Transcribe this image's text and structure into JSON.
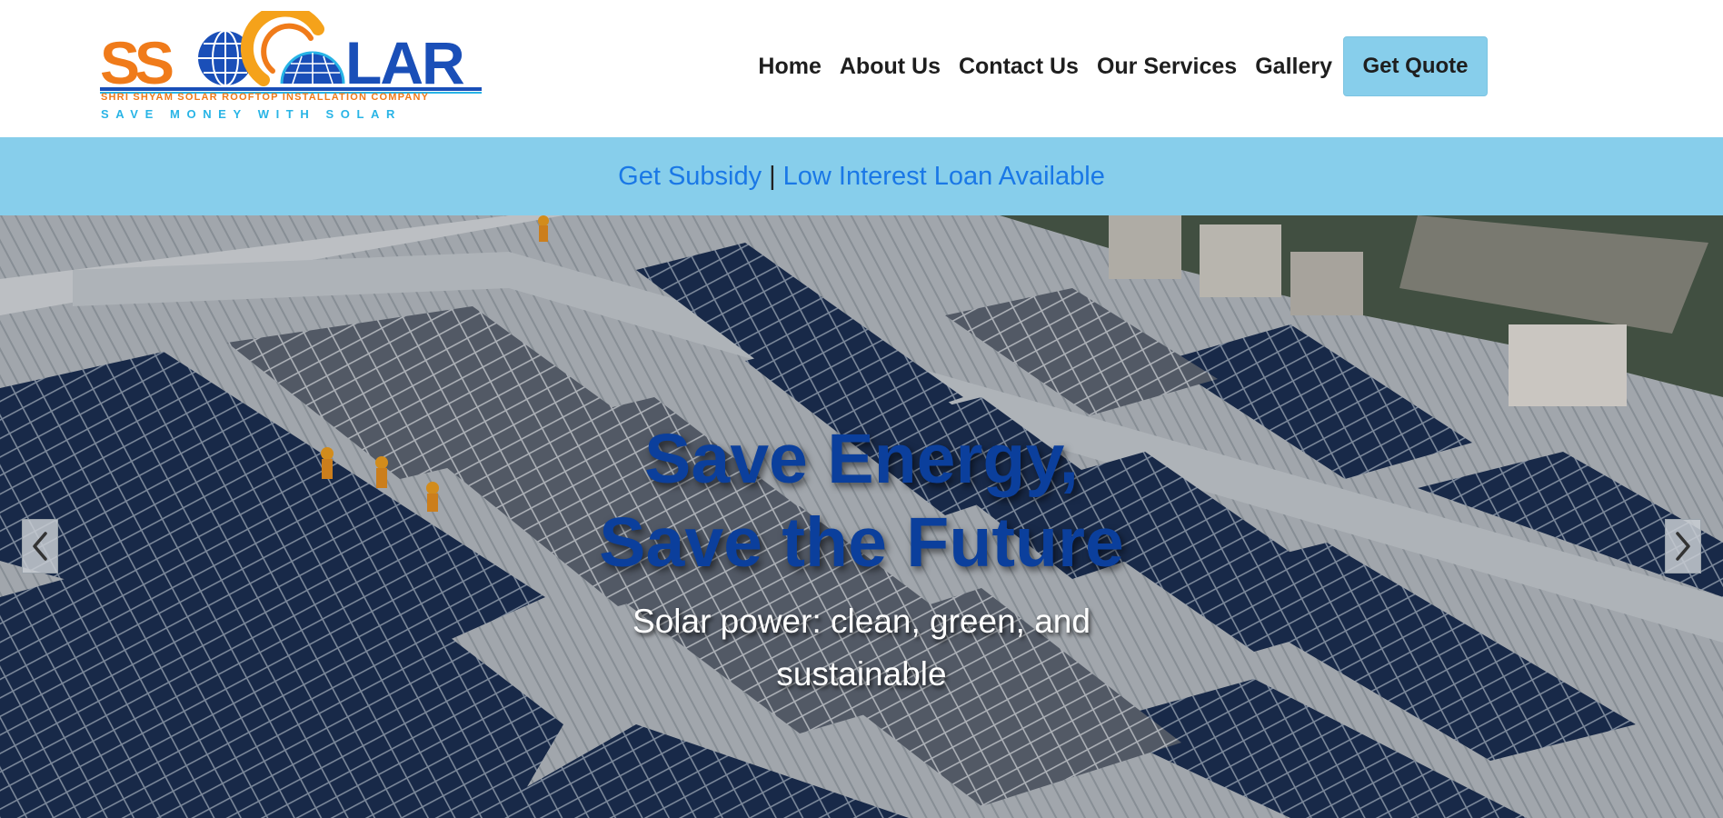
{
  "header": {
    "logo": {
      "wordmark": "SSOLAR",
      "tagline": "SHRI SHYAM SOLAR ROOFTOP INSTALLATION COMPANY",
      "slogan": "SAVE MONEY WITH SOLAR"
    },
    "nav": [
      {
        "label": "Home"
      },
      {
        "label": "About Us"
      },
      {
        "label": "Contact Us"
      },
      {
        "label": "Our Services"
      },
      {
        "label": "Gallery"
      }
    ],
    "cta_label": "Get Quote"
  },
  "announcement": {
    "subsidy": "Get Subsidy",
    "separator": "|",
    "loan": "Low Interest Loan Available"
  },
  "hero": {
    "title": "Save Energy, Save the Future",
    "subtitle": "Solar power: clean, green, and sustainable",
    "prev_icon": "chevron-left-icon",
    "next_icon": "chevron-right-icon"
  },
  "colors": {
    "bar": "#87ceeb",
    "link": "#1a78e6",
    "hero_title": "#0b3f9c",
    "logo_orange": "#f07b1a",
    "logo_blue": "#1a4fb8",
    "logo_cyan": "#28b4e6"
  }
}
